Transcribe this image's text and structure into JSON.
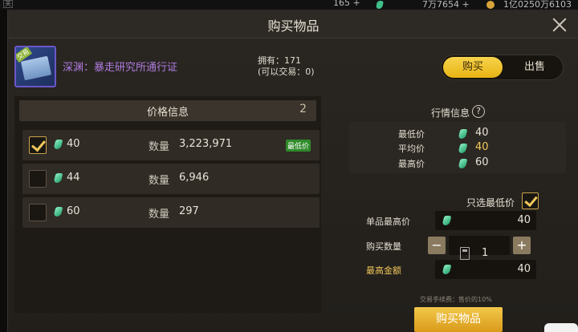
{
  "topbar": {
    "menu_glyph": "关",
    "resource1": "165",
    "resource2": "7万7654",
    "resource3": "1亿0250万6103",
    "plus": "+"
  },
  "dialog": {
    "title": "购买物品",
    "item": {
      "badge": "交易",
      "name": "深渊：暴走研究所通行证",
      "owned": "拥有：171",
      "tradeable": "(可以交易：0)"
    },
    "tabs": {
      "buy": "购买",
      "sell": "出售",
      "active": "buy"
    },
    "price_info": {
      "title": "价格信息",
      "count": "2",
      "qty_label": "数量",
      "rows": [
        {
          "price": "40",
          "qty": "3,223,971",
          "badge": "最低价",
          "checked": true
        },
        {
          "price": "44",
          "qty": "6,946",
          "badge": "",
          "checked": false
        },
        {
          "price": "60",
          "qty": "297",
          "badge": "",
          "checked": false
        }
      ]
    },
    "market": {
      "title": "行情信息",
      "help": "?",
      "min_label": "最低价",
      "min": "40",
      "avg_label": "平均价",
      "avg": "40",
      "max_label": "最高价",
      "max": "60"
    },
    "lowest_only": {
      "label": "只选最低价",
      "checked": true
    },
    "form": {
      "unit_max_label": "单品最高价",
      "unit_max": "40",
      "qty_label": "购买数量",
      "qty": "1",
      "minus": "−",
      "plus": "+",
      "total_label": "最高金额",
      "total": "40",
      "fee": "交易手续费：售价的10%"
    },
    "buy_button": "购买物品"
  },
  "colors": {
    "accent": "#f0c75a",
    "gem": "#3fbf8a",
    "item_name": "#b07be0"
  }
}
